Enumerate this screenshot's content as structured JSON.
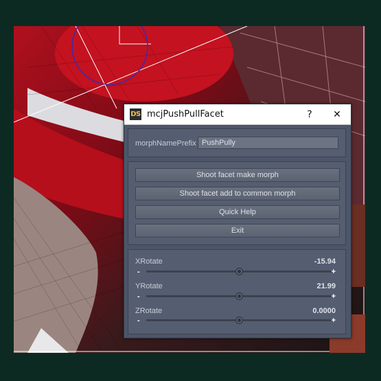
{
  "window": {
    "logo": "DS",
    "title": "mcjPushPullFacet",
    "help_label": "?",
    "close_label": "✕"
  },
  "prefix": {
    "label": "morphNamePrefix",
    "value": "PushPully"
  },
  "buttons": [
    "Shoot facet make morph",
    "Shoot facet add to common morph",
    "Quick Help",
    "Exit"
  ],
  "sliders": [
    {
      "name": "XRotate",
      "value": "-15.94",
      "position": 0.5
    },
    {
      "name": "YRotate",
      "value": "21.99",
      "position": 0.5
    },
    {
      "name": "ZRotate",
      "value": "0.0000",
      "position": 0.5
    }
  ],
  "slider_symbols": {
    "minus": "-",
    "plus": "+"
  }
}
